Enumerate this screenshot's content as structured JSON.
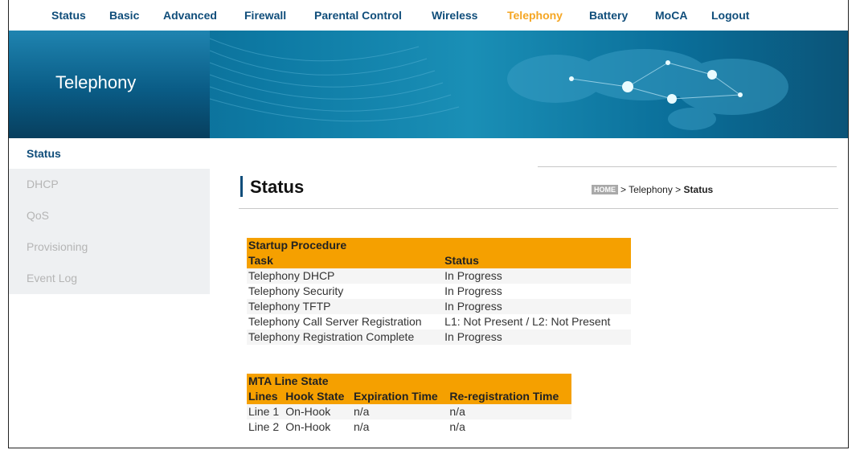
{
  "nav": {
    "items": [
      "Status",
      "Basic",
      "Advanced",
      "Firewall",
      "Parental Control",
      "Wireless",
      "Telephony",
      "Battery",
      "MoCA",
      "Logout"
    ],
    "active": "Telephony"
  },
  "banner": {
    "title": "Telephony"
  },
  "sidebar": {
    "items": [
      "Status",
      "DHCP",
      "QoS",
      "Provisioning",
      "Event Log"
    ],
    "active": "Status"
  },
  "page": {
    "title": "Status"
  },
  "breadcrumb": {
    "home": "HOME",
    "section": "Telephony",
    "current": "Status"
  },
  "startup": {
    "caption": "Startup Procedure",
    "headers": [
      "Task",
      "Status"
    ],
    "rows": [
      [
        "Telephony DHCP",
        "In Progress"
      ],
      [
        "Telephony Security",
        "In Progress"
      ],
      [
        "Telephony TFTP",
        "In Progress"
      ],
      [
        "Telephony Call Server Registration",
        "L1: Not Present / L2: Not Present"
      ],
      [
        "Telephony Registration Complete",
        "In Progress"
      ]
    ]
  },
  "mta": {
    "caption": "MTA Line State",
    "headers": [
      "Lines",
      "Hook State",
      "Expiration Time",
      "Re-registration Time"
    ],
    "rows": [
      [
        "Line 1",
        "On-Hook",
        "n/a",
        "n/a"
      ],
      [
        "Line 2",
        "On-Hook",
        "n/a",
        "n/a"
      ]
    ]
  },
  "colors": {
    "accent": "#f5a000",
    "nav_text": "#0f4d7a",
    "nav_active": "#f5a623",
    "banner": "#0b5f86"
  }
}
